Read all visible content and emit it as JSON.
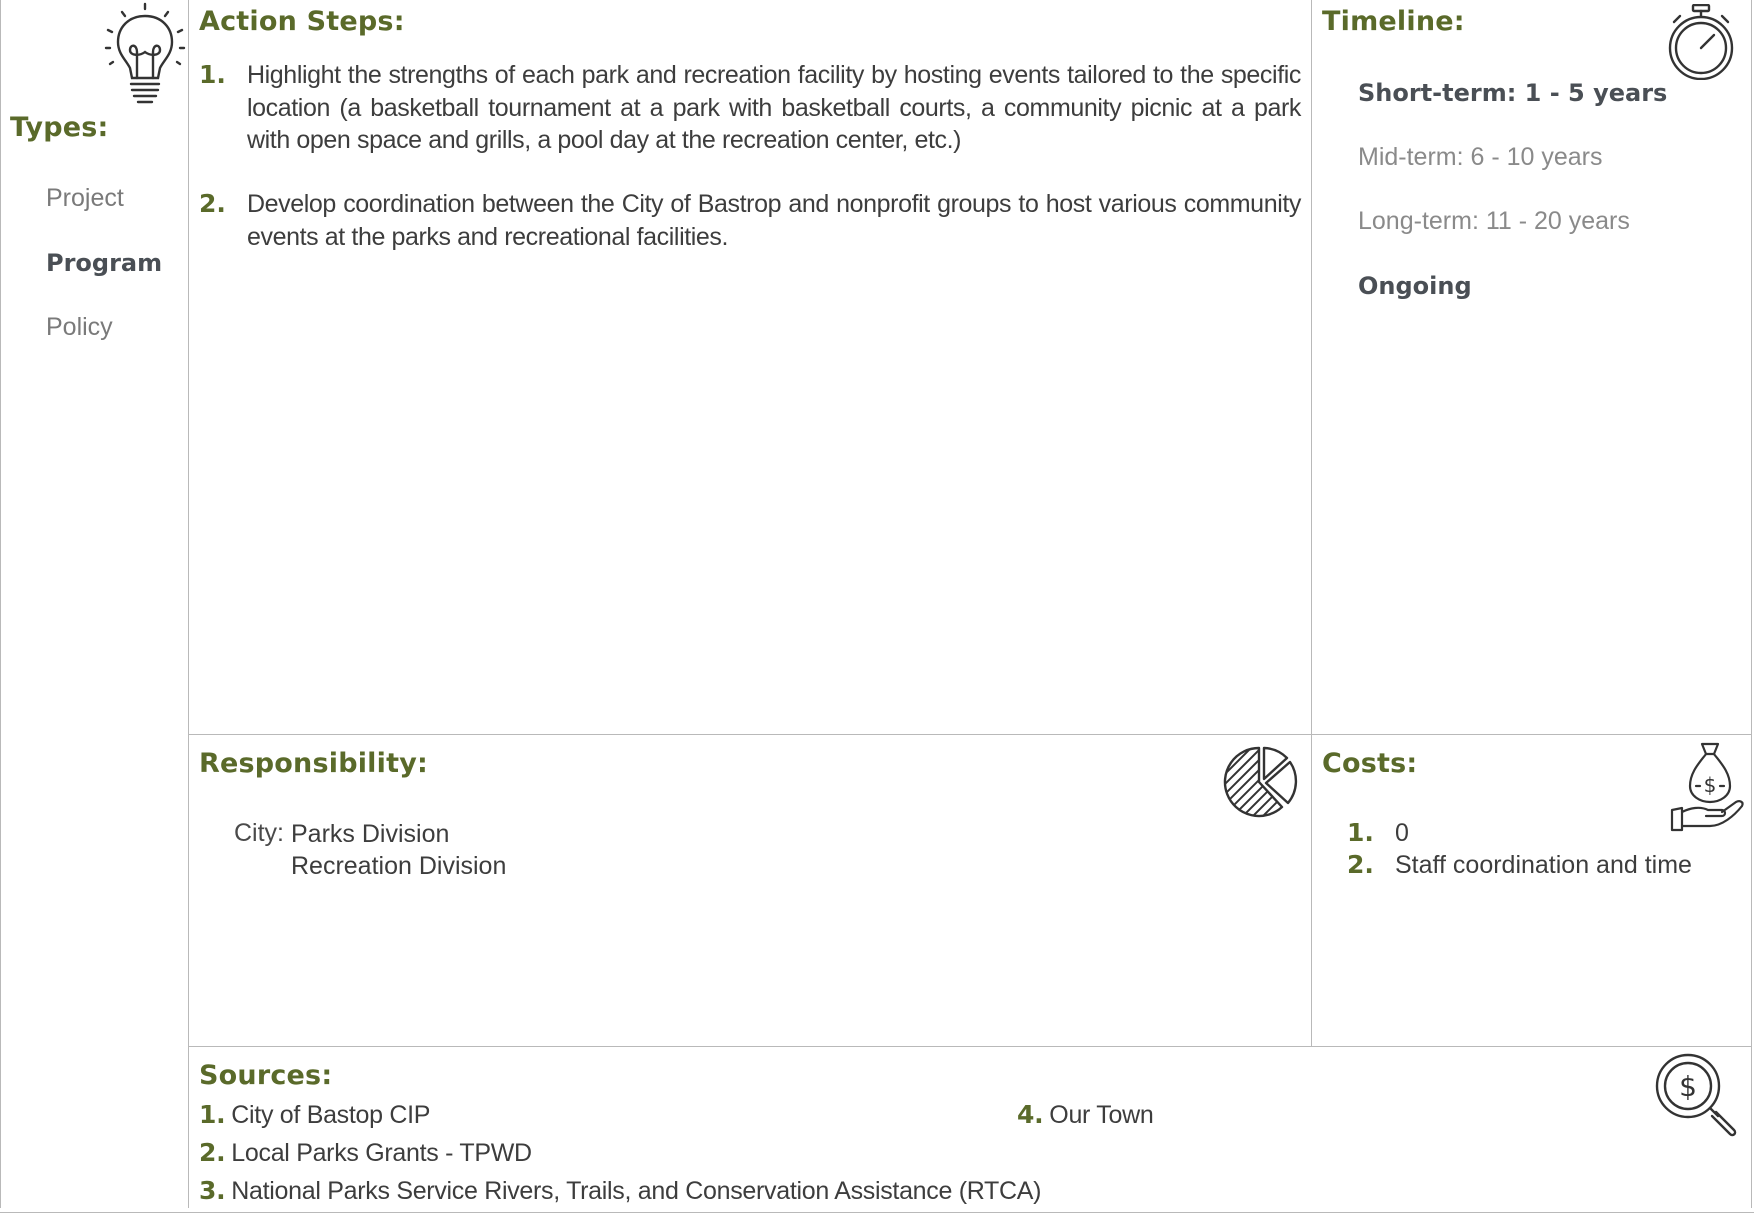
{
  "types": {
    "heading": "Types:",
    "items": [
      {
        "label": "Project",
        "active": false
      },
      {
        "label": "Program",
        "active": true
      },
      {
        "label": "Policy",
        "active": false
      }
    ]
  },
  "action_steps": {
    "heading": "Action Steps:",
    "steps": [
      {
        "num": "1.",
        "text": "Highlight the strengths of each park and recreation facility by hosting events tailored to the specific location (a basketball tournament at a park with basketball courts, a community picnic at a park with open space and grills, a pool day at the recreation center, etc.)"
      },
      {
        "num": "2.",
        "text": "Develop coordination between the City of Bastrop and nonprofit groups to host various community events at the parks and recreational facilities."
      }
    ]
  },
  "timeline": {
    "heading": "Timeline:",
    "items": [
      {
        "label": "Short-term:  1 - 5 years",
        "active": true
      },
      {
        "label": "Mid-term:  6 - 10 years",
        "active": false
      },
      {
        "label": "Long-term:  11 - 20 years",
        "active": false
      },
      {
        "label": "Ongoing",
        "active": true
      }
    ]
  },
  "responsibility": {
    "heading": "Responsibility:",
    "label": "City:",
    "values": [
      "Parks Division",
      "Recreation Division"
    ]
  },
  "costs": {
    "heading": "Costs:",
    "items": [
      {
        "num": "1.",
        "text": "0"
      },
      {
        "num": "2.",
        "text": "Staff coordination and time"
      }
    ]
  },
  "sources": {
    "heading": "Sources:",
    "items": [
      {
        "num": "1.",
        "text": "City of Bastop CIP"
      },
      {
        "num": "2.",
        "text": "Local Parks Grants - TPWD"
      },
      {
        "num": "3.",
        "text": "National Parks Service Rivers, Trails, and Conservation Assistance (RTCA)"
      },
      {
        "num": "4.",
        "text": "Our Town"
      }
    ]
  },
  "icons": {
    "types": "lightbulb-icon",
    "timeline": "stopwatch-icon",
    "responsibility": "pie-chart-icon",
    "costs": "money-bag-hand-icon",
    "sources": "magnifier-dollar-icon"
  },
  "colors": {
    "heading": "#5a6a2a",
    "active_text": "#4a4f55",
    "inactive_text": "#8a8a8a",
    "body_text": "#3d3d3d",
    "rule": "#b9b9b9"
  }
}
